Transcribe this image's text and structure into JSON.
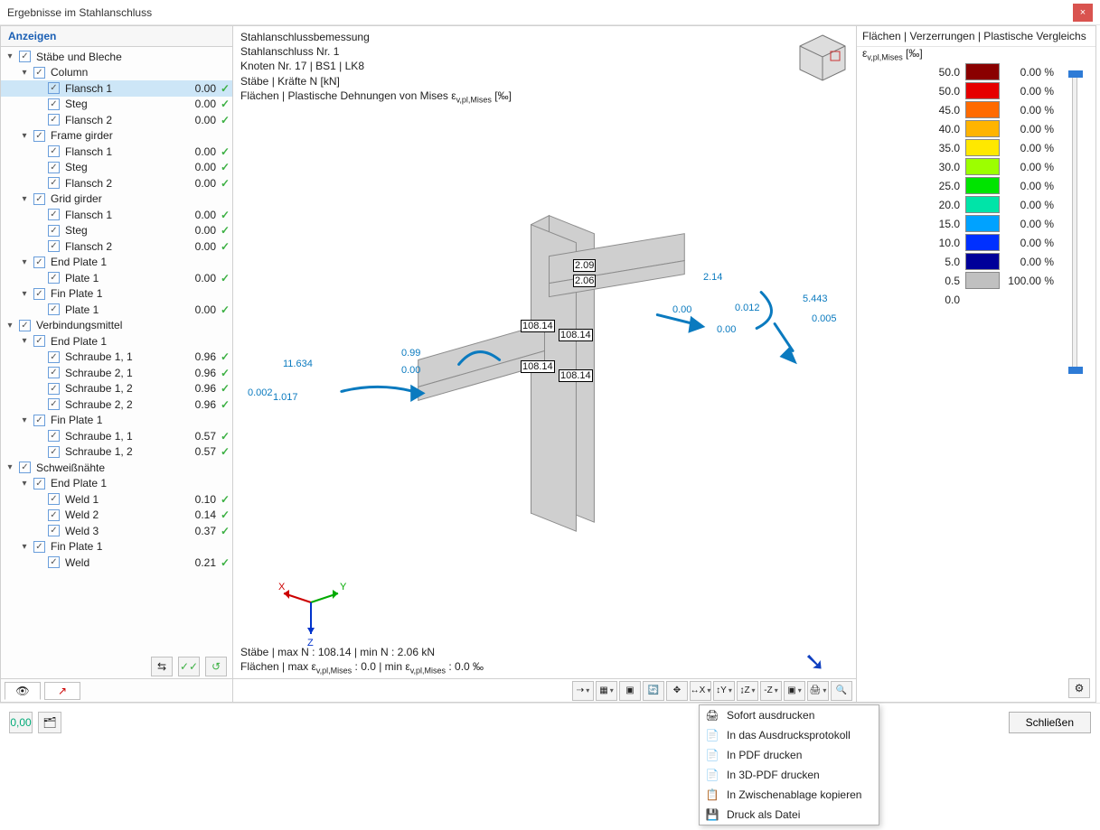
{
  "window": {
    "title": "Ergebnisse im Stahlanschluss",
    "close": "×"
  },
  "left": {
    "heading": "Anzeigen",
    "tree": [
      {
        "indent": 0,
        "chev": "▾",
        "check": true,
        "label": "Stäbe und Bleche"
      },
      {
        "indent": 1,
        "chev": "▾",
        "check": true,
        "label": "Column"
      },
      {
        "indent": 2,
        "chev": "",
        "check": true,
        "label": "Flansch 1",
        "value": "0.00",
        "ok": true,
        "selected": true
      },
      {
        "indent": 2,
        "chev": "",
        "check": true,
        "label": "Steg",
        "value": "0.00",
        "ok": true
      },
      {
        "indent": 2,
        "chev": "",
        "check": true,
        "label": "Flansch 2",
        "value": "0.00",
        "ok": true
      },
      {
        "indent": 1,
        "chev": "▾",
        "check": true,
        "label": "Frame girder"
      },
      {
        "indent": 2,
        "chev": "",
        "check": true,
        "label": "Flansch 1",
        "value": "0.00",
        "ok": true
      },
      {
        "indent": 2,
        "chev": "",
        "check": true,
        "label": "Steg",
        "value": "0.00",
        "ok": true
      },
      {
        "indent": 2,
        "chev": "",
        "check": true,
        "label": "Flansch 2",
        "value": "0.00",
        "ok": true
      },
      {
        "indent": 1,
        "chev": "▾",
        "check": true,
        "label": "Grid girder"
      },
      {
        "indent": 2,
        "chev": "",
        "check": true,
        "label": "Flansch 1",
        "value": "0.00",
        "ok": true
      },
      {
        "indent": 2,
        "chev": "",
        "check": true,
        "label": "Steg",
        "value": "0.00",
        "ok": true
      },
      {
        "indent": 2,
        "chev": "",
        "check": true,
        "label": "Flansch 2",
        "value": "0.00",
        "ok": true
      },
      {
        "indent": 1,
        "chev": "▾",
        "check": true,
        "label": "End Plate 1"
      },
      {
        "indent": 2,
        "chev": "",
        "check": true,
        "label": "Plate 1",
        "value": "0.00",
        "ok": true
      },
      {
        "indent": 1,
        "chev": "▾",
        "check": true,
        "label": "Fin Plate 1"
      },
      {
        "indent": 2,
        "chev": "",
        "check": true,
        "label": "Plate 1",
        "value": "0.00",
        "ok": true
      },
      {
        "indent": 0,
        "chev": "▾",
        "check": true,
        "label": "Verbindungsmittel"
      },
      {
        "indent": 1,
        "chev": "▾",
        "check": true,
        "label": "End Plate 1"
      },
      {
        "indent": 2,
        "chev": "",
        "check": true,
        "label": "Schraube 1, 1",
        "value": "0.96",
        "ok": true
      },
      {
        "indent": 2,
        "chev": "",
        "check": true,
        "label": "Schraube 2, 1",
        "value": "0.96",
        "ok": true
      },
      {
        "indent": 2,
        "chev": "",
        "check": true,
        "label": "Schraube 1, 2",
        "value": "0.96",
        "ok": true
      },
      {
        "indent": 2,
        "chev": "",
        "check": true,
        "label": "Schraube 2, 2",
        "value": "0.96",
        "ok": true
      },
      {
        "indent": 1,
        "chev": "▾",
        "check": true,
        "label": "Fin Plate 1"
      },
      {
        "indent": 2,
        "chev": "",
        "check": true,
        "label": "Schraube 1, 1",
        "value": "0.57",
        "ok": true
      },
      {
        "indent": 2,
        "chev": "",
        "check": true,
        "label": "Schraube 1, 2",
        "value": "0.57",
        "ok": true
      },
      {
        "indent": 0,
        "chev": "▾",
        "check": true,
        "label": "Schweißnähte"
      },
      {
        "indent": 1,
        "chev": "▾",
        "check": true,
        "label": "End Plate 1"
      },
      {
        "indent": 2,
        "chev": "",
        "check": true,
        "label": "Weld 1",
        "value": "0.10",
        "ok": true
      },
      {
        "indent": 2,
        "chev": "",
        "check": true,
        "label": "Weld 2",
        "value": "0.14",
        "ok": true
      },
      {
        "indent": 2,
        "chev": "",
        "check": true,
        "label": "Weld 3",
        "value": "0.37",
        "ok": true
      },
      {
        "indent": 1,
        "chev": "▾",
        "check": true,
        "label": "Fin Plate 1"
      },
      {
        "indent": 2,
        "chev": "",
        "check": true,
        "label": "Weld",
        "value": "0.21",
        "ok": true
      }
    ]
  },
  "center": {
    "lines": [
      "Stahlanschlussbemessung",
      "Stahlanschluss Nr. 1",
      "Knoten Nr. 17 | BS1 | LK8",
      "Stäbe | Kräfte N [kN]",
      "Flächen | Plastische Dehnungen von Mises εv,pl,Mises [‰]"
    ],
    "bottom1": "Stäbe | max N : 108.14 | min N : 2.06 kN",
    "bottom2": "Flächen | max εv,pl,Mises : 0.0 | min εv,pl,Mises : 0.0 ‰",
    "annotations_black": [
      "2.09",
      "2.06",
      "108.14",
      "108.14",
      "108.14",
      "108.14"
    ],
    "annotations_blue": [
      "11.634",
      "0.002",
      "1.017",
      "0.99",
      "0.00",
      "0.00",
      "2.14",
      "0.012",
      "0.00",
      "5.443",
      "0.005"
    ],
    "axes": {
      "x": "X",
      "y": "Y",
      "z": "Z"
    }
  },
  "right": {
    "title": "Flächen | Verzerrungen | Plastische Vergleichs",
    "subtitle": "εv,pl,Mises [‰]",
    "legend": [
      {
        "num": "50.0",
        "swatch": "#8a0000",
        "pct": "0.00 %"
      },
      {
        "num": "50.0",
        "swatch": "#e60000",
        "pct": "0.00 %"
      },
      {
        "num": "45.0",
        "swatch": "#ff6a00",
        "pct": "0.00 %"
      },
      {
        "num": "40.0",
        "swatch": "#ffb400",
        "pct": "0.00 %"
      },
      {
        "num": "35.0",
        "swatch": "#ffe800",
        "pct": "0.00 %"
      },
      {
        "num": "30.0",
        "swatch": "#9cff00",
        "pct": "0.00 %"
      },
      {
        "num": "25.0",
        "swatch": "#00e400",
        "pct": "0.00 %"
      },
      {
        "num": "20.0",
        "swatch": "#00e4a8",
        "pct": "0.00 %"
      },
      {
        "num": "15.0",
        "swatch": "#00a2ff",
        "pct": "0.00 %"
      },
      {
        "num": "10.0",
        "swatch": "#0030ff",
        "pct": "0.00 %"
      },
      {
        "num": "5.0",
        "swatch": "#000099",
        "pct": "0.00 %"
      },
      {
        "num": "0.5",
        "swatch": "#c0c0c0",
        "pct": "100.00 %"
      },
      {
        "num": "0.0",
        "swatch": "",
        "pct": ""
      }
    ]
  },
  "footer": {
    "close": "Schließen"
  },
  "printMenu": [
    {
      "icon": "🖨",
      "label": "Sofort ausdrucken"
    },
    {
      "icon": "📄",
      "label": "In das Ausdrucksprotokoll"
    },
    {
      "icon": "📄",
      "label": "In PDF drucken"
    },
    {
      "icon": "📄",
      "label": "In 3D-PDF drucken"
    },
    {
      "icon": "📋",
      "label": "In Zwischenablage kopieren"
    },
    {
      "icon": "💾",
      "label": "Druck als Datei"
    }
  ]
}
